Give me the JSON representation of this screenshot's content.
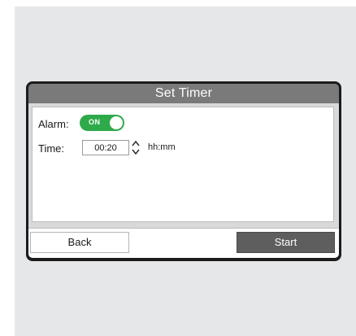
{
  "dialog": {
    "title": "Set Timer"
  },
  "alarm": {
    "label": "Alarm:",
    "toggle_text": "ON",
    "enabled": true,
    "toggle_color": "#2eaa4a"
  },
  "time": {
    "label": "Time:",
    "value": "00:20",
    "unit": "hh:mm",
    "spinner_icon": "up-down-chevron-icon"
  },
  "footer": {
    "back_label": "Back",
    "start_label": "Start"
  }
}
